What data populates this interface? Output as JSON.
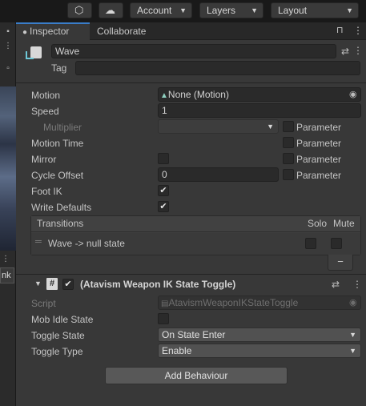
{
  "toolbar": {
    "account_label": "Account",
    "layers_label": "Layers",
    "layout_label": "Layout"
  },
  "sidebar": {
    "link_label": "nk"
  },
  "tabs": [
    {
      "label": "Inspector"
    },
    {
      "label": "Collaborate"
    }
  ],
  "header": {
    "name_value": "Wave",
    "tag_label": "Tag",
    "tag_value": ""
  },
  "fields": {
    "motion_label": "Motion",
    "motion_value": "None (Motion)",
    "speed_label": "Speed",
    "speed_value": "1",
    "multiplier_label": "Multiplier",
    "motion_time_label": "Motion Time",
    "mirror_label": "Mirror",
    "cycle_offset_label": "Cycle Offset",
    "cycle_offset_value": "0",
    "foot_ik_label": "Foot IK",
    "foot_ik_checked": "✔",
    "write_defaults_label": "Write Defaults",
    "write_defaults_checked": "✔",
    "parameter_label": "Parameter"
  },
  "transitions": {
    "header": "Transitions",
    "solo_label": "Solo",
    "mute_label": "Mute",
    "rows": [
      {
        "label": "Wave -> null state"
      }
    ],
    "remove_label": "−"
  },
  "component": {
    "title": "(Atavism Weapon IK State Toggle)",
    "enabled_check": "✔",
    "script_label": "Script",
    "script_value": "AtavismWeaponIKStateToggle",
    "mob_idle_label": "Mob Idle State",
    "toggle_state_label": "Toggle State",
    "toggle_state_value": "On State Enter",
    "toggle_type_label": "Toggle Type",
    "toggle_type_value": "Enable"
  },
  "add_behaviour_label": "Add Behaviour",
  "colors": {
    "accent": "#3a7dc9",
    "panel_bg": "#383838",
    "toolbar_bg": "#191919"
  }
}
